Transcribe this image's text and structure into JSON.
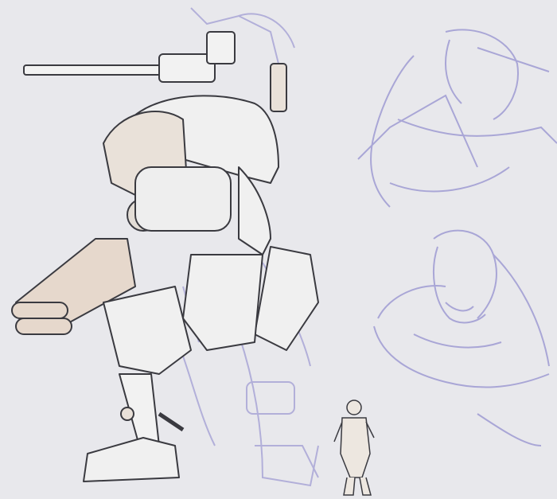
{
  "colors": {
    "background": "#e8e8ec",
    "sketch": "#a9a6d6",
    "ink": "#3a3a40",
    "fill": "#d8cfc6"
  }
}
